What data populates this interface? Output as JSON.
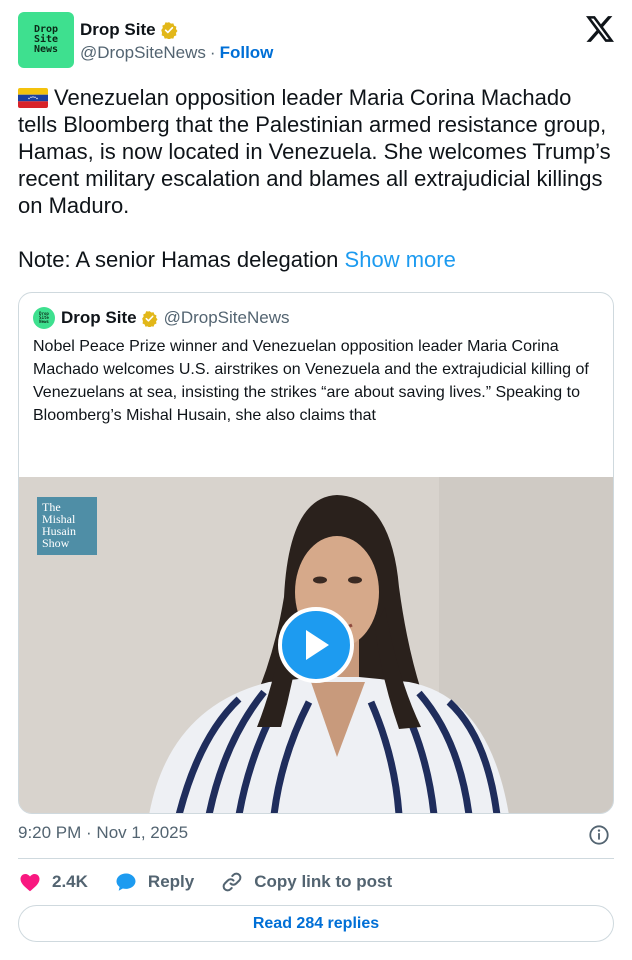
{
  "author": {
    "avatar_text": [
      "Drop",
      "Site",
      "News"
    ],
    "display_name": "Drop Site",
    "handle": "@DropSiteNews",
    "separator": "·",
    "follow_label": "Follow"
  },
  "tweet": {
    "text_main": "Venezuelan opposition leader Maria Corina Machado tells Bloomberg that the Palestinian armed resistance group, Hamas, is now located in Venezuela. She welcomes Trump’s recent military escalation and blames all extrajudicial killings on Maduro.",
    "text_note": "Note: A senior Hamas delegation",
    "show_more_label": "Show more",
    "timestamp": "9:20 PM · Nov 1, 2025"
  },
  "quoted_tweet": {
    "display_name": "Drop Site",
    "handle": "@DropSiteNews",
    "text": "Nobel Peace Prize winner and Venezuelan opposition leader Maria Corina Machado welcomes U.S. airstrikes on Venezuela and the extrajudicial killing of Venezuelans at sea, insisting the strikes “are about saving lives.” Speaking to Bloomberg’s Mishal Husain, she also claims that",
    "video_logo_lines": [
      "The",
      "Mishal",
      "Husain",
      "Show"
    ]
  },
  "actions": {
    "likes_count": "2.4K",
    "reply_label": "Reply",
    "copy_link_label": "Copy link to post",
    "read_replies_label": "Read 284 replies"
  },
  "icons": {
    "verified": "verified-badge-icon",
    "x_logo": "x-logo-icon",
    "info": "info-icon",
    "heart": "heart-icon",
    "reply": "reply-bubble-icon",
    "link": "link-icon",
    "play": "play-icon",
    "flag": "venezuela-flag-icon"
  },
  "colors": {
    "brand_green": "#3ee08f",
    "link_blue": "#1d9bf0",
    "follow_blue": "#006fd6",
    "heart_pink": "#f91880",
    "verified_gold": "#e2b719",
    "secondary_text": "#536471",
    "border": "#cfd9de"
  }
}
